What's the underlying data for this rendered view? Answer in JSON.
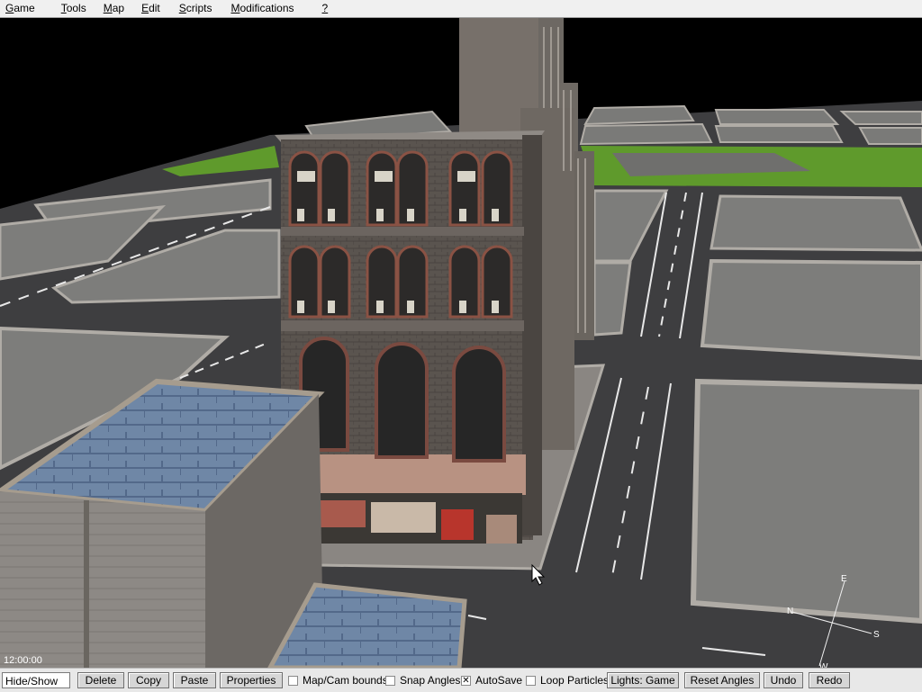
{
  "menu": {
    "items": [
      {
        "accel": "G",
        "rest": "ame"
      },
      {
        "accel": "T",
        "rest": "ools"
      },
      {
        "accel": "M",
        "rest": "ap"
      },
      {
        "accel": "E",
        "rest": "dit"
      },
      {
        "accel": "S",
        "rest": "cripts"
      },
      {
        "accel": "M",
        "rest": "odifications"
      },
      {
        "accel": "?",
        "rest": ""
      }
    ]
  },
  "viewport": {
    "clock": "12:00:00",
    "compass": {
      "n": "N",
      "e": "E",
      "s": "S",
      "w": "W"
    }
  },
  "toolbar": {
    "hide_show": "Hide/Show",
    "delete": "Delete",
    "copy": "Copy",
    "paste": "Paste",
    "properties": "Properties",
    "map_cam_bounds": {
      "label": "Map/Cam bounds",
      "checked": false
    },
    "snap_angles": {
      "label": "Snap Angles",
      "checked": false
    },
    "autosave": {
      "label": "AutoSave",
      "checked": true
    },
    "loop_particles": {
      "label": "Loop Particles",
      "checked": false
    },
    "lights": "Lights: Game",
    "reset_angles": "Reset Angles",
    "undo": "Undo",
    "redo": "Redo"
  },
  "colors": {
    "sky": "#000000",
    "road": "#3e3e40",
    "block": "#7d7d7b",
    "grass": "#5f9a2c",
    "building": "#5c5652"
  }
}
